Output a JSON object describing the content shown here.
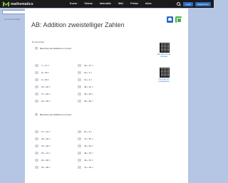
{
  "header": {
    "logo_text": "mathematics",
    "nav": [
      "Kurse",
      "Videos",
      "Interaktiv",
      "Wiki",
      "Preise",
      "Infos"
    ],
    "login_label": "Login",
    "register_label": "Registrieren"
  },
  "search": {
    "placeholder": "Suche Arbeitsblatt"
  },
  "page": {
    "title": "AB: Addition zweistelliger Zahlen",
    "meta": "Arbeitsblatt"
  },
  "tasks": [
    {
      "number": "1",
      "instruction": "Berechne die Additionen im Kopf.",
      "left": [
        {
          "num": "a)",
          "expr": "7 + 17 ="
        },
        {
          "num": "b)",
          "expr": "8 + 49 ="
        },
        {
          "num": "c)",
          "expr": "6 + 50 ="
        },
        {
          "num": "d)",
          "expr": "16 + 20 ="
        },
        {
          "num": "e)",
          "expr": "17 + 40 ="
        },
        {
          "num": "f)",
          "expr": "19 + 53 ="
        }
      ],
      "right": [
        {
          "num": "g)",
          "expr": "20 + 17 ="
        },
        {
          "num": "h)",
          "expr": "19 + 1 ="
        },
        {
          "num": "i)",
          "expr": "19 + 2 ="
        },
        {
          "num": "j)",
          "expr": "48 + 21 ="
        },
        {
          "num": "k)",
          "expr": "46 + 40 ="
        },
        {
          "num": "l)",
          "expr": "35 + 60 ="
        }
      ]
    },
    {
      "number": "2",
      "instruction": "Berechne die Additionen im Kopf.",
      "left": [
        {
          "num": "a)",
          "expr": "17 + 31 ="
        },
        {
          "num": "b)",
          "expr": "24 + 49 ="
        },
        {
          "num": "c)",
          "expr": "16 + 26 ="
        },
        {
          "num": "d)",
          "expr": "15 + 27 ="
        },
        {
          "num": "e)",
          "expr": "22 + 52 ="
        },
        {
          "num": "f)",
          "expr": "15 + 38 ="
        }
      ],
      "right": [
        {
          "num": "g)",
          "expr": "87 + 9 ="
        },
        {
          "num": "h)",
          "expr": "47 + 87 ="
        },
        {
          "num": "i)",
          "expr": "46 + 22 ="
        },
        {
          "num": "j)",
          "expr": "48 + 37 ="
        },
        {
          "num": "k)",
          "expr": "49 + 37 ="
        },
        {
          "num": "l)",
          "expr": "73 + 30 ="
        }
      ]
    }
  ],
  "qr": [
    {
      "caption": "Hier findest du die Lösungen"
    },
    {
      "caption": "Hier findest du Lösungsvideos"
    }
  ]
}
